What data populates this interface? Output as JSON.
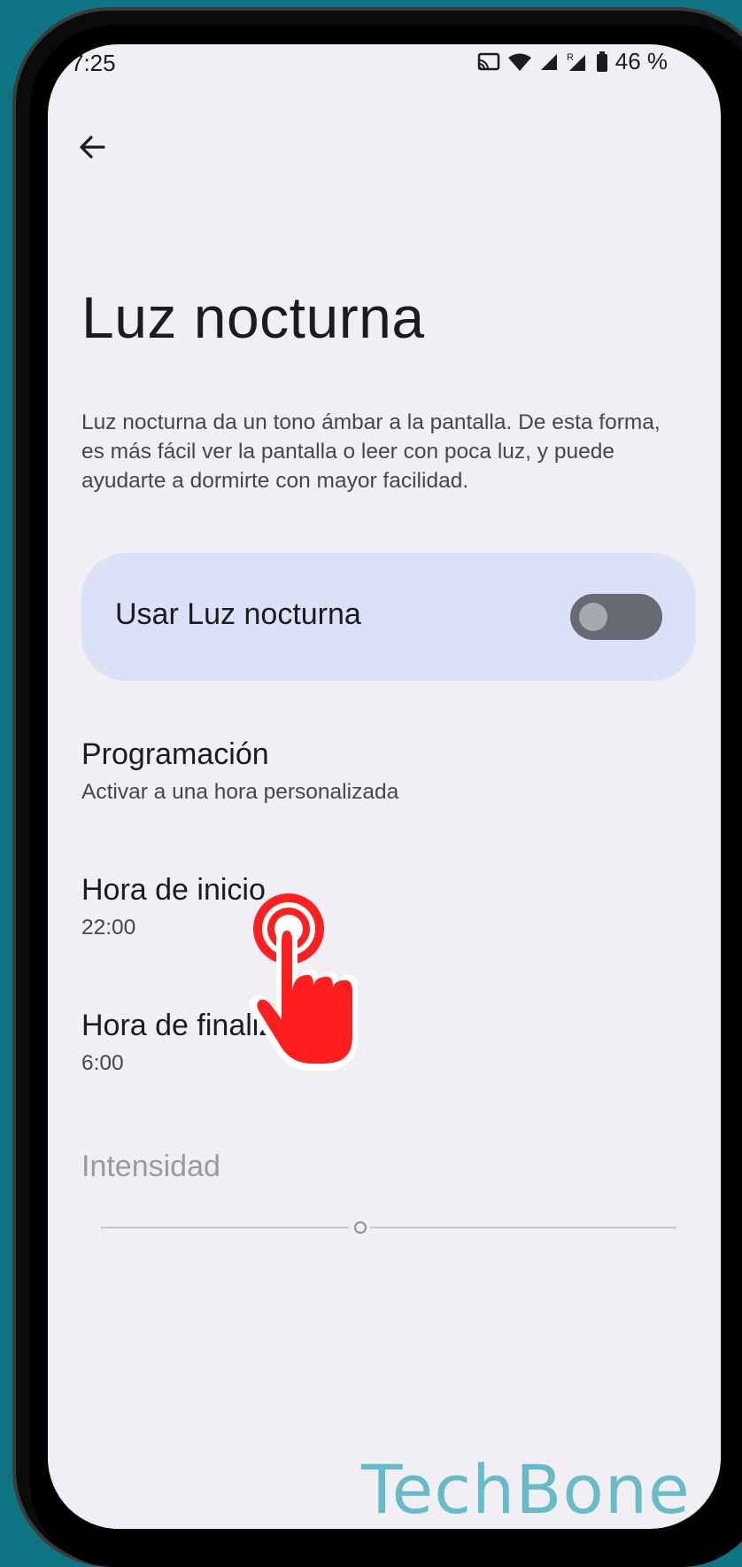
{
  "status_bar": {
    "time": "7:25",
    "battery_text": "46 %",
    "icons": [
      "cast-icon",
      "wifi-icon",
      "signal-icon",
      "signal-roaming-icon",
      "battery-icon"
    ]
  },
  "header": {
    "back_icon": "arrow-left-icon",
    "title": "Luz nocturna"
  },
  "description": "Luz nocturna da un tono ámbar a la pantalla. De esta forma, es más fácil ver la pantalla o leer con poca luz, y puede ayudarte a dormirte con mayor facilidad.",
  "main_toggle": {
    "label": "Usar Luz nocturna",
    "checked": false
  },
  "settings": [
    {
      "title": "Programación",
      "summary": "Activar a una hora personalizada"
    },
    {
      "title": "Hora de inicio",
      "summary": "22:00"
    },
    {
      "title": "Hora de finalización",
      "summary": "6:00"
    }
  ],
  "intensity": {
    "label": "Intensidad",
    "enabled": false,
    "value": 0.45
  },
  "watermark": "TechBone",
  "colors": {
    "background": "#0e7383",
    "screen": "#f1eff3",
    "toggle_card": "#dbe1f6",
    "tap_indicator": "#ff1f1f",
    "watermark": "#5fb9c6"
  }
}
